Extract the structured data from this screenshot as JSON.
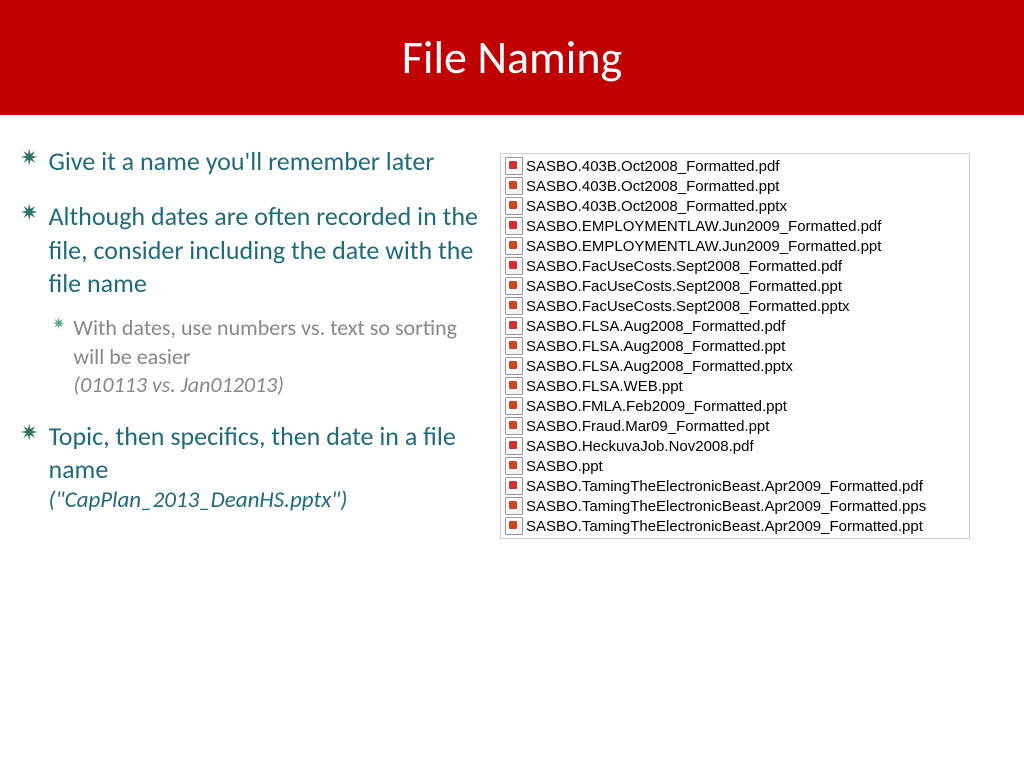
{
  "title": "File Naming",
  "bullets": [
    {
      "text": "Give it a name you'll remember later",
      "sub": []
    },
    {
      "text": "Although dates are often recorded in the file, consider including the date with the file name",
      "sub": [
        {
          "text": "With dates, use numbers vs. text so sorting will be easier",
          "ex": "(010113 vs. Jan012013)"
        }
      ]
    },
    {
      "text": "Topic, then specifics, then date in a file name",
      "example": "(\"CapPlan_2013_DeanHS.pptx\")",
      "sub": []
    }
  ],
  "files": [
    {
      "name": "SASBO.403B.Oct2008_Formatted.pdf",
      "type": "pdf"
    },
    {
      "name": "SASBO.403B.Oct2008_Formatted.ppt",
      "type": "ppt"
    },
    {
      "name": "SASBO.403B.Oct2008_Formatted.pptx",
      "type": "pptx"
    },
    {
      "name": "SASBO.EMPLOYMENTLAW.Jun2009_Formatted.pdf",
      "type": "pdf"
    },
    {
      "name": "SASBO.EMPLOYMENTLAW.Jun2009_Formatted.ppt",
      "type": "ppt"
    },
    {
      "name": "SASBO.FacUseCosts.Sept2008_Formatted.pdf",
      "type": "pdf"
    },
    {
      "name": "SASBO.FacUseCosts.Sept2008_Formatted.ppt",
      "type": "ppt"
    },
    {
      "name": "SASBO.FacUseCosts.Sept2008_Formatted.pptx",
      "type": "pptx"
    },
    {
      "name": "SASBO.FLSA.Aug2008_Formatted.pdf",
      "type": "pdf"
    },
    {
      "name": "SASBO.FLSA.Aug2008_Formatted.ppt",
      "type": "ppt"
    },
    {
      "name": "SASBO.FLSA.Aug2008_Formatted.pptx",
      "type": "pptx"
    },
    {
      "name": "SASBO.FLSA.WEB.ppt",
      "type": "ppt"
    },
    {
      "name": "SASBO.FMLA.Feb2009_Formatted.ppt",
      "type": "ppt"
    },
    {
      "name": "SASBO.Fraud.Mar09_Formatted.ppt",
      "type": "ppt"
    },
    {
      "name": "SASBO.HeckuvaJob.Nov2008.pdf",
      "type": "pdf"
    },
    {
      "name": "SASBO.ppt",
      "type": "ppt"
    },
    {
      "name": "SASBO.TamingTheElectronicBeast.Apr2009_Formatted.pdf",
      "type": "pdf"
    },
    {
      "name": "SASBO.TamingTheElectronicBeast.Apr2009_Formatted.pps",
      "type": "pps"
    },
    {
      "name": "SASBO.TamingTheElectronicBeast.Apr2009_Formatted.ppt",
      "type": "ppt"
    }
  ]
}
